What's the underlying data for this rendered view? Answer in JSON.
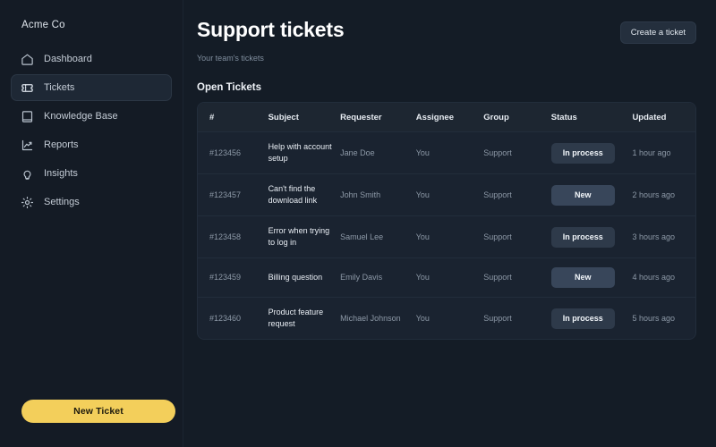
{
  "sidebar": {
    "brand": "Acme Co",
    "items": [
      {
        "label": "Dashboard",
        "icon": "home-icon",
        "active": false
      },
      {
        "label": "Tickets",
        "icon": "ticket-icon",
        "active": true
      },
      {
        "label": "Knowledge Base",
        "icon": "book-icon",
        "active": false
      },
      {
        "label": "Reports",
        "icon": "chart-line-icon",
        "active": false
      },
      {
        "label": "Insights",
        "icon": "lightbulb-icon",
        "active": false
      },
      {
        "label": "Settings",
        "icon": "gear-icon",
        "active": false
      }
    ],
    "new_ticket_label": "New Ticket"
  },
  "header": {
    "title": "Support tickets",
    "subtitle": "Your team's tickets",
    "create_button": "Create a ticket"
  },
  "section": {
    "title": "Open Tickets"
  },
  "table": {
    "columns": [
      "#",
      "Subject",
      "Requester",
      "Assignee",
      "Group",
      "Status",
      "Updated"
    ],
    "rows": [
      {
        "id": "#123456",
        "subject": "Help with account setup",
        "requester": "Jane Doe",
        "assignee": "You",
        "group": "Support",
        "status": "In process",
        "status_kind": "inprocess",
        "updated": "1 hour ago"
      },
      {
        "id": "#123457",
        "subject": "Can't find the download link",
        "requester": "John Smith",
        "assignee": "You",
        "group": "Support",
        "status": "New",
        "status_kind": "new",
        "updated": "2 hours ago"
      },
      {
        "id": "#123458",
        "subject": "Error when trying to log in",
        "requester": "Samuel Lee",
        "assignee": "You",
        "group": "Support",
        "status": "In process",
        "status_kind": "inprocess",
        "updated": "3 hours ago"
      },
      {
        "id": "#123459",
        "subject": "Billing question",
        "requester": "Emily Davis",
        "assignee": "You",
        "group": "Support",
        "status": "New",
        "status_kind": "new",
        "updated": "4 hours ago"
      },
      {
        "id": "#123460",
        "subject": "Product feature request",
        "requester": "Michael Johnson",
        "assignee": "You",
        "group": "Support",
        "status": "In process",
        "status_kind": "inprocess",
        "updated": "5 hours ago"
      }
    ]
  },
  "colors": {
    "background": "#141c26",
    "panel": "#1a2330",
    "accent_yellow": "#f3cf5b",
    "badge_inprocess": "#2e3a4a",
    "badge_new": "#38465a"
  }
}
